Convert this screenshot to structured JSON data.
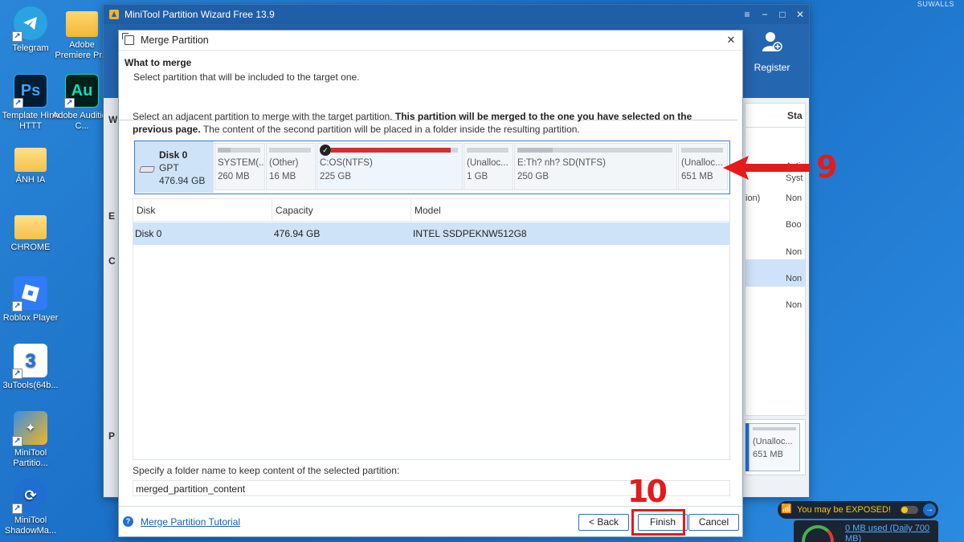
{
  "desktop": {
    "watermark": "SUWALLS",
    "icons": [
      {
        "label": "Telegram",
        "icon": "telegram-icon"
      },
      {
        "label": "Adobe Premiere Pr...",
        "icon": "folder-icon"
      },
      {
        "label": "Template Hình HTTT",
        "icon": "photoshop-icon",
        "glyph": "Ps"
      },
      {
        "label": "Adobe Audition C...",
        "icon": "audition-icon",
        "glyph": "Au"
      },
      {
        "label": "ẢNH IA",
        "icon": "folder-icon"
      },
      {
        "label": "CHROME",
        "icon": "folder-icon"
      },
      {
        "label": "Roblox Player",
        "icon": "roblox-icon"
      },
      {
        "label": "3uTools(64b...",
        "icon": "3utools-icon"
      },
      {
        "label": "MiniTool Partitio...",
        "icon": "minitool-icon"
      },
      {
        "label": "MiniTool ShadowMa...",
        "icon": "shadowmaker-icon"
      }
    ]
  },
  "main_window": {
    "title": "MiniTool Partition Wizard Free 13.9",
    "register_label": "Register",
    "status_header": "Sta",
    "status_cells": [
      "Activ",
      "Syst",
      "Non",
      "Boo",
      "Non",
      "Non",
      "Non"
    ],
    "left_fragment": "ion)",
    "left_letters": [
      "P",
      "W",
      "E",
      "C",
      "P"
    ],
    "disk_card": {
      "name": "(Unalloc...",
      "size": "651 MB"
    }
  },
  "dialog": {
    "title": "Merge Partition",
    "heading": "What to merge",
    "subheading": "Select partition that will be included to the target one.",
    "instruction_plain_1": "Select an adjacent partition to merge with the target partition. ",
    "instruction_bold": "This partition will be merged to the one you have selected on the previous page.",
    "instruction_plain_2": " The content of the second partition will be placed in a folder inside the resulting partition.",
    "disk": {
      "name": "Disk 0",
      "type": "GPT",
      "size": "476.94 GB"
    },
    "partitions": [
      {
        "name": "SYSTEM(...",
        "size": "260 MB",
        "used": 0.3
      },
      {
        "name": "(Other)",
        "size": "16 MB",
        "used": 0.0
      },
      {
        "name": "C:OS(NTFS)",
        "size": "225 GB",
        "used": 0.94,
        "selected": true
      },
      {
        "name": "(Unalloc...",
        "size": "1 GB",
        "used": 0.0
      },
      {
        "name": "E:Th? nh? SD(NTFS)",
        "size": "250 GB",
        "used": 0.23
      },
      {
        "name": "(Unalloc...",
        "size": "651 MB",
        "used": 0.0
      }
    ],
    "table": {
      "headers": [
        "Disk",
        "Capacity",
        "Model"
      ],
      "rows": [
        [
          "Disk 0",
          "476.94 GB",
          "INTEL SSDPEKNW512G8"
        ]
      ]
    },
    "folder_label": "Specify a folder name to keep content of the selected partition:",
    "folder_value": "merged_partition_content",
    "tutorial_link": "Merge Partition Tutorial",
    "back_label": "< Back",
    "finish_label": "Finish",
    "cancel_label": "Cancel"
  },
  "annotations": {
    "step_9": "9",
    "step_10": "10"
  },
  "tray": {
    "warning": "You may be EXPOSED!",
    "usage": "0 MB used (Daily 700 MB)"
  },
  "colors": {
    "accent": "#1f5fa8",
    "selection": "#cfe3f8",
    "annotation_red": "#e31b1b",
    "used_bar_red": "#d32f2f"
  }
}
